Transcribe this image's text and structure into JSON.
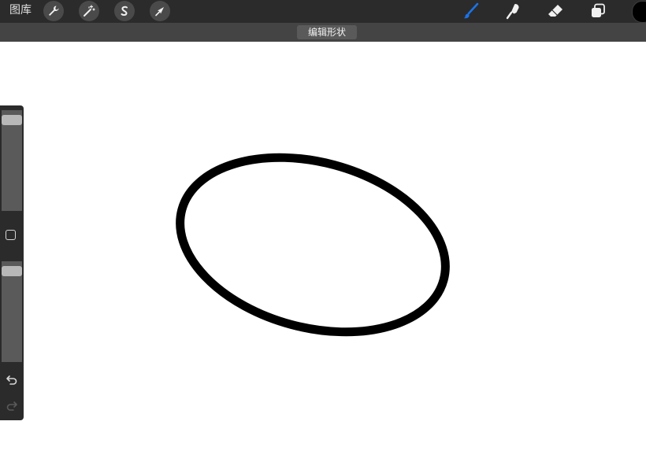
{
  "topbar": {
    "gallery_label": "图库",
    "left_tools": [
      "wrench-icon",
      "magic-wand-icon",
      "selection-icon",
      "transform-arrow-icon"
    ],
    "right_tools": [
      "brush-icon",
      "smudge-icon",
      "eraser-icon",
      "layers-icon"
    ],
    "active_tool": "brush-icon",
    "active_color": "#1a73e8",
    "current_color": "#000000"
  },
  "subbar": {
    "mode_label": "编辑形状"
  },
  "canvas": {
    "shape": "ellipse",
    "stroke_color": "#000000"
  },
  "sidebar": {
    "brush_size_level": 0.05,
    "opacity_level": 0.05
  }
}
